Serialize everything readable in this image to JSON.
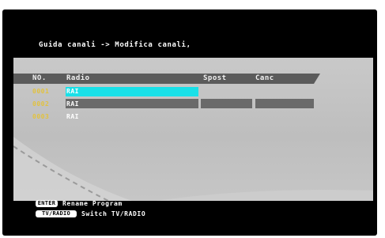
{
  "screen": {
    "breadcrumb": "Guida canali -> Modifica canali,"
  },
  "table": {
    "headers": {
      "no": "NO.",
      "radio": "Radio",
      "spost": "Spost",
      "canc": "Canc"
    },
    "rows": [
      {
        "no": "0001",
        "name": "RAI",
        "selected": true
      },
      {
        "no": "0002",
        "name": "RAI",
        "selected": false
      },
      {
        "no": "0003",
        "name": "RAI",
        "selected": false
      }
    ]
  },
  "footer": {
    "enter_key": "ENTER",
    "enter_label": "Rename Program",
    "tvradio_key": "TV/RADIO",
    "tvradio_label": "Switch TV/RADIO"
  },
  "colors": {
    "highlight": "#19e0e8",
    "header": "#5b5b5b",
    "number": "#e2c23f"
  }
}
